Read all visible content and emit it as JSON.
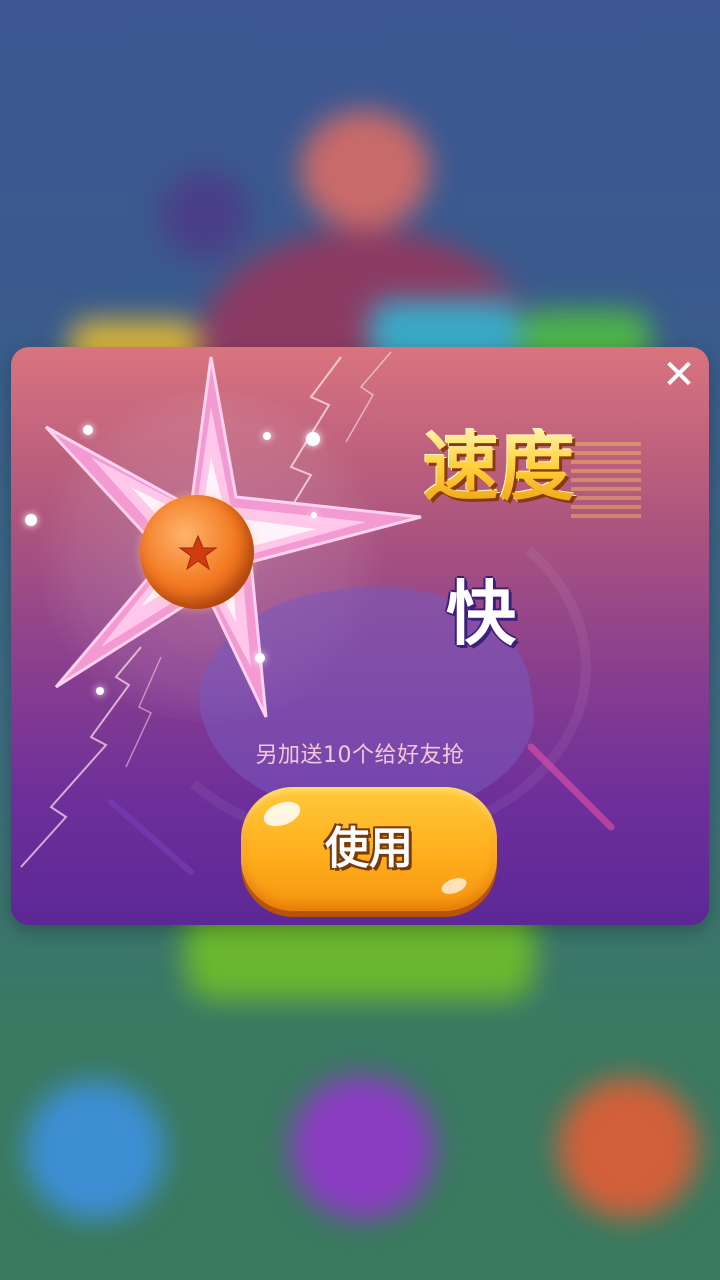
{
  "background": {
    "description_colors": {
      "top": "#3c5794",
      "bottom": "#3a7a5e"
    }
  },
  "popup": {
    "close_label": "✕",
    "title": "速度",
    "value": "快",
    "subtext": "另加送10个给好友抢",
    "use_button_label": "使用"
  },
  "colors": {
    "title_gold": "#ffcf3a",
    "button_orange": "#ffae1d",
    "card_top": "#d9747e",
    "card_bottom": "#5c2896",
    "orb": "#f37a22"
  },
  "icons": {
    "powerup": "dragon-ball-star-icon",
    "close": "close-icon"
  }
}
